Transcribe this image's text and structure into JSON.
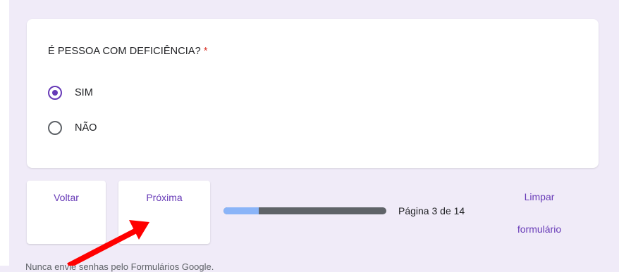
{
  "question": {
    "text": "É PESSOA COM DEFICIÊNCIA?",
    "required_mark": "*"
  },
  "options": [
    {
      "label": "SIM",
      "checked": true
    },
    {
      "label": "NÃO",
      "checked": false
    }
  ],
  "navigation": {
    "back_label": "Voltar",
    "next_label": "Próxima"
  },
  "progress": {
    "fraction": 0.2143,
    "page_text": "Página 3 de 14"
  },
  "clear_form": {
    "line1": "Limpar",
    "line2": "formulário"
  },
  "footer": {
    "text": "Nunca envie senhas pelo Formulários Google."
  },
  "colors": {
    "accent": "#673ab7",
    "required": "#d93025",
    "background": "#f0ebf8",
    "progress_fill": "#8ab4f8",
    "progress_track": "#5f6368",
    "annotation_arrow": "#ff0000"
  }
}
